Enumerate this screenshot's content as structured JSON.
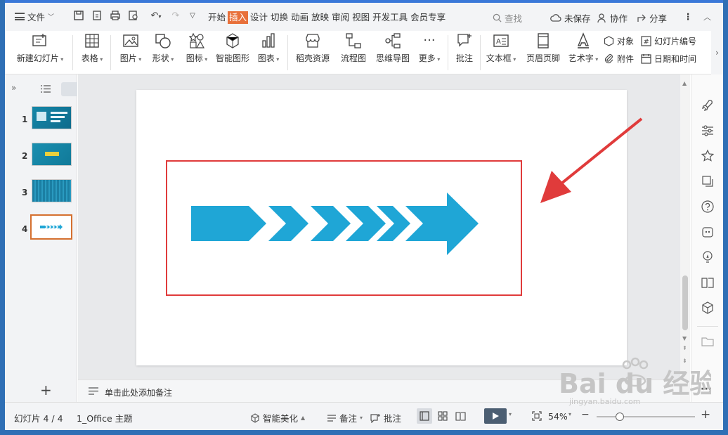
{
  "menu": {
    "file_label": "文件",
    "tabs": [
      "开始",
      "插入",
      "设计",
      "切换",
      "动画",
      "放映",
      "审阅",
      "视图",
      "开发工具",
      "会员专享"
    ],
    "active_tab": "插入",
    "search_label": "查找",
    "unsaved_label": "未保存",
    "collab_label": "协作",
    "share_label": "分享"
  },
  "ribbon": {
    "new_slide": "新建幻灯片",
    "table": "表格",
    "picture": "图片",
    "shape": "形状",
    "icon": "图标",
    "smartart": "智能图形",
    "chart": "图表",
    "docer": "稻壳资源",
    "flowchart": "流程图",
    "mindmap": "思维导图",
    "more": "更多",
    "comment": "批注",
    "textbox": "文本框",
    "header_footer": "页眉页脚",
    "wordart": "艺术字",
    "object": "对象",
    "attachment": "附件",
    "slide_number": "幻灯片编号",
    "datetime": "日期和时间"
  },
  "slides": {
    "numbers": [
      "1",
      "2",
      "3",
      "4"
    ],
    "selected": "4"
  },
  "notes": {
    "placeholder": "单击此处添加备注"
  },
  "status": {
    "slide_counter": "幻灯片 4 / 4",
    "theme": "1_Office 主题",
    "smart_beautify": "智能美化",
    "notes": "备注",
    "comments": "批注",
    "zoom": "54%"
  },
  "colors": {
    "arrow_fill": "#1fa6d6",
    "highlight_box": "#e03b3b",
    "active_tab_bg": "#e8703a",
    "selected_thumb_border": "#d5702f"
  },
  "watermark": {
    "brand": "Bai du 经验",
    "url": "jingyan.baidu.com"
  }
}
